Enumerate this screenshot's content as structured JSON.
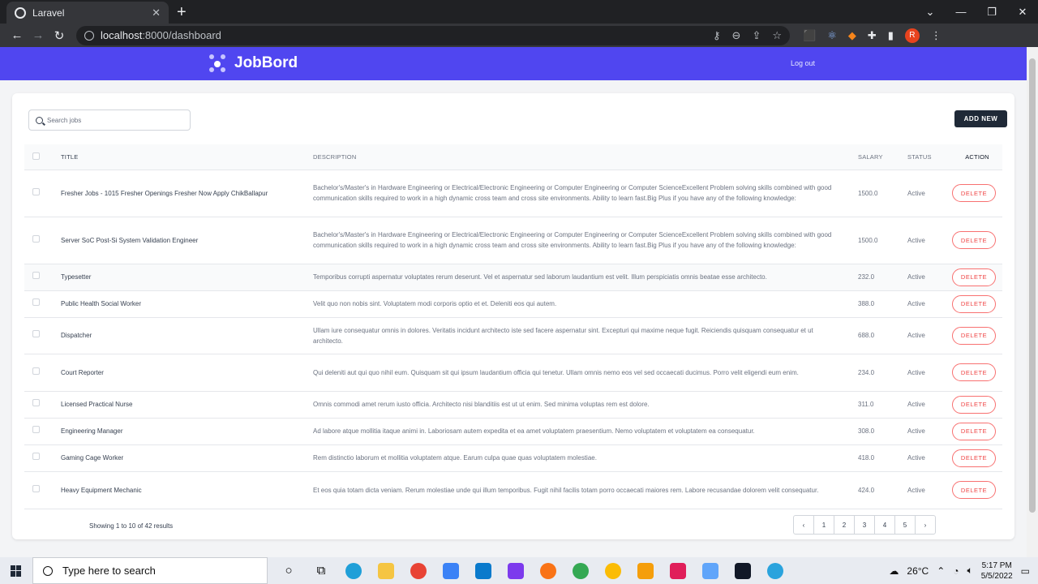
{
  "browser": {
    "tab_title": "Laravel",
    "url_host": "localhost",
    "url_path": ":8000/dashboard",
    "avatar_letter": "R"
  },
  "app": {
    "brand": "JobBord",
    "logout": "Log out",
    "accent": "#5046f0"
  },
  "toolbar": {
    "search_placeholder": "Search jobs",
    "add_new": "ADD NEW"
  },
  "table": {
    "headers": {
      "title": "TITLE",
      "description": "DESCRIPTION",
      "salary": "SALARY",
      "status": "STATUS",
      "action": "ACTION"
    },
    "delete_label": "DELETE",
    "rows": [
      {
        "title": "Fresher Jobs - 1015 Fresher Openings Fresher Now Apply ChikBallapur",
        "description": "Bachelor's/Master's in Hardware Engineering or Electrical/Electronic Engineering or Computer Engineering or Computer ScienceExcellent Problem solving skills combined with good communication skills required to work in a high dynamic cross team and cross site environments. Ability to learn fast.Big Plus if you have any of the following knowledge:",
        "salary": "1500.0",
        "status": "Active"
      },
      {
        "title": "Server SoC Post-Si System Validation Engineer",
        "description": "Bachelor's/Master's in Hardware Engineering or Electrical/Electronic Engineering or Computer Engineering or Computer ScienceExcellent Problem solving skills combined with good communication skills required to work in a high dynamic cross team and cross site environments. Ability to learn fast.Big Plus if you have any of the following knowledge:",
        "salary": "1500.0",
        "status": "Active"
      },
      {
        "title": "Typesetter",
        "description": "Temporibus corrupti aspernatur voluptates rerum deserunt. Vel et aspernatur sed laborum laudantium est velit. Illum perspiciatis omnis beatae esse architecto.",
        "salary": "232.0",
        "status": "Active"
      },
      {
        "title": "Public Health Social Worker",
        "description": "Velit quo non nobis sint. Voluptatem modi corporis optio et et. Deleniti eos qui autem.",
        "salary": "388.0",
        "status": "Active"
      },
      {
        "title": "Dispatcher",
        "description": "Ullam iure consequatur omnis in dolores. Veritatis incidunt architecto iste sed facere aspernatur sint. Excepturi qui maxime neque fugit. Reiciendis quisquam consequatur et ut architecto.",
        "salary": "688.0",
        "status": "Active"
      },
      {
        "title": "Court Reporter",
        "description": "Qui deleniti aut qui quo nihil eum. Quisquam sit qui ipsum laudantium officia qui tenetur. Ullam omnis nemo eos vel sed occaecati ducimus. Porro velit eligendi eum enim.",
        "salary": "234.0",
        "status": "Active"
      },
      {
        "title": "Licensed Practical Nurse",
        "description": "Omnis commodi amet rerum iusto officia. Architecto nisi blanditiis est ut ut enim. Sed minima voluptas rem est dolore.",
        "salary": "311.0",
        "status": "Active"
      },
      {
        "title": "Engineering Manager",
        "description": "Ad labore atque mollitia itaque animi in. Laboriosam autem expedita et ea amet voluptatem praesentium. Nemo voluptatem et voluptatem ea consequatur.",
        "salary": "308.0",
        "status": "Active"
      },
      {
        "title": "Gaming Cage Worker",
        "description": "Rem distinctio laborum et mollitia voluptatem atque. Earum culpa quae quas voluptatem molestiae.",
        "salary": "418.0",
        "status": "Active"
      },
      {
        "title": "Heavy Equipment Mechanic",
        "description": "Et eos quia totam dicta veniam. Rerum molestiae unde qui illum temporibus. Fugit nihil facilis totam porro occaecati maiores rem. Labore recusandae dolorem velit consequatur.",
        "salary": "424.0",
        "status": "Active"
      }
    ]
  },
  "pagination": {
    "summary": "Showing 1 to 10 of 42 results",
    "prev": "‹",
    "pages": [
      "1",
      "2",
      "3",
      "4",
      "5"
    ],
    "next": "›"
  },
  "taskbar": {
    "search_placeholder": "Type here to search",
    "temperature": "26°C",
    "time": "5:17 PM",
    "date": "5/5/2022"
  }
}
